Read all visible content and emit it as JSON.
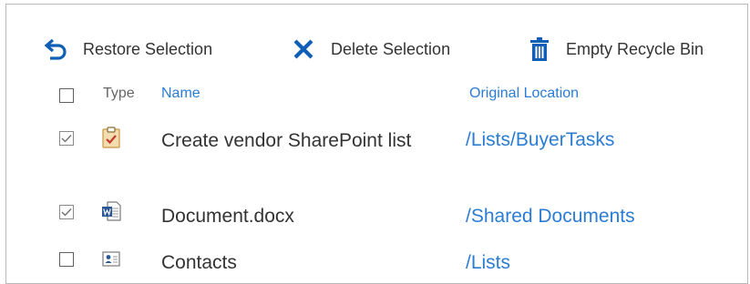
{
  "toolbar": {
    "restore_label": "Restore Selection",
    "delete_label": "Delete Selection",
    "empty_label": "Empty Recycle Bin"
  },
  "columns": {
    "type": "Type",
    "name": "Name",
    "location": "Original Location"
  },
  "rows": [
    {
      "checked": true,
      "type_icon": "task-icon",
      "name": "Create vendor SharePoint list",
      "location": "/Lists/BuyerTasks"
    },
    {
      "checked": true,
      "type_icon": "word-doc-icon",
      "name": "Document.docx",
      "location": "/Shared Documents"
    },
    {
      "checked": false,
      "type_icon": "contact-card-icon",
      "name": "Contacts",
      "location": "/Lists"
    }
  ],
  "colors": {
    "accent": "#0f5fb6",
    "link": "#2b7cd3",
    "text": "#333333",
    "border": "#b9b9b9"
  }
}
